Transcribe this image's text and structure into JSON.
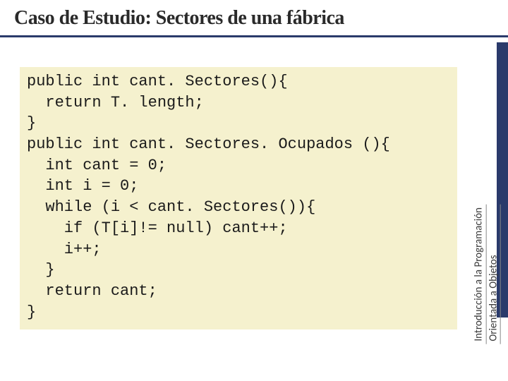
{
  "slide": {
    "title": "Caso de Estudio: Sectores de una fábrica"
  },
  "code": {
    "content": "public int cant. Sectores(){\n  return T. length;\n}\npublic int cant. Sectores. Ocupados (){\n  int cant = 0;\n  int i = 0;\n  while (i < cant. Sectores()){\n    if (T[i]!= null) cant++;\n    i++;\n  }\n  return cant;\n}"
  },
  "sidebar": {
    "line1": "Introducción a la Programación",
    "line2": "Orientada a Objetos"
  }
}
